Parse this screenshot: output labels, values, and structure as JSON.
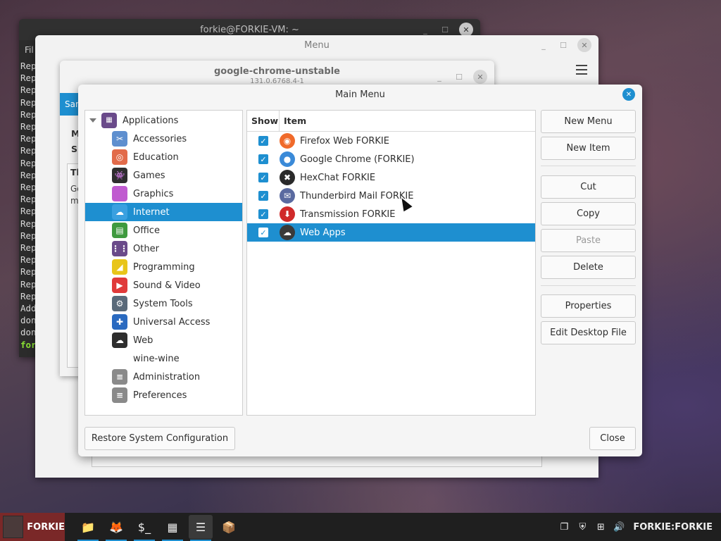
{
  "terminal": {
    "title": "forkie@FORKIE-VM: ~",
    "menu_stub": "Fil",
    "lines": [
      "Rep",
      "Rep",
      "Rep",
      "Rep",
      "Rep",
      "Rep",
      "Rep",
      "Rep",
      "Rep",
      "Rep",
      "Rep",
      "Rep",
      "Rep",
      "Rep",
      "Rep",
      "Rep",
      "Rep",
      "Rep",
      "Rep",
      "Rep",
      "Add",
      "don",
      "don"
    ],
    "prompt": "for"
  },
  "menu_window": {
    "title": "Menu"
  },
  "chrome_dialog": {
    "title": "google-chrome-unstable",
    "subtitle": "131.0.6768.4-1",
    "tab_stub": "Sam",
    "stub1": "M",
    "stub2": "Si",
    "frame_title": "Th",
    "frame_body1": "Go",
    "frame_body2": "m"
  },
  "main_dialog": {
    "title": "Main Menu",
    "tree_root": "Applications",
    "categories": [
      {
        "label": "Accessories",
        "icon": "accessories-icon",
        "color": "#5e8fcf",
        "glyph": "✂"
      },
      {
        "label": "Education",
        "icon": "education-icon",
        "color": "#e26b4a",
        "glyph": "◎"
      },
      {
        "label": "Games",
        "icon": "games-icon",
        "color": "#2e2e2e",
        "glyph": "👾"
      },
      {
        "label": "Graphics",
        "icon": "graphics-icon",
        "color": "#c05bd0",
        "glyph": ""
      },
      {
        "label": "Internet",
        "icon": "internet-icon",
        "color": "#3aa0e0",
        "glyph": "☁",
        "selected": true
      },
      {
        "label": "Office",
        "icon": "office-icon",
        "color": "#3f9a3f",
        "glyph": "▤"
      },
      {
        "label": "Other",
        "icon": "other-icon",
        "color": "#6a4a8a",
        "glyph": "⋮⋮"
      },
      {
        "label": "Programming",
        "icon": "programming-icon",
        "color": "#e8c51a",
        "glyph": "◢"
      },
      {
        "label": "Sound & Video",
        "icon": "sound-video-icon",
        "color": "#e03a3a",
        "glyph": "▶"
      },
      {
        "label": "System Tools",
        "icon": "system-tools-icon",
        "color": "#5a6a7a",
        "glyph": "⚙"
      },
      {
        "label": "Universal Access",
        "icon": "universal-access-icon",
        "color": "#2a6ac0",
        "glyph": "✚"
      },
      {
        "label": "Web",
        "icon": "web-icon",
        "color": "#2e2e2e",
        "glyph": "☁"
      },
      {
        "label": "wine-wine",
        "icon": "",
        "color": "",
        "glyph": "",
        "noicon": true
      },
      {
        "label": "Administration",
        "icon": "administration-icon",
        "color": "#8a8a8a",
        "glyph": "≡"
      },
      {
        "label": "Preferences",
        "icon": "preferences-icon",
        "color": "#8a8a8a",
        "glyph": "≡"
      }
    ],
    "table_headers": {
      "show": "Show",
      "item": "Item"
    },
    "items": [
      {
        "label": "Firefox Web FORKIE",
        "icon": "firefox-icon",
        "color": "#f06a2a",
        "glyph": "◉",
        "checked": true
      },
      {
        "label": "Google Chrome (FORKIE)",
        "icon": "chrome-icon",
        "color": "#3a8ad8",
        "glyph": "●",
        "checked": true
      },
      {
        "label": "HexChat FORKIE",
        "icon": "hexchat-icon",
        "color": "#2a2a2a",
        "glyph": "✖",
        "checked": true
      },
      {
        "label": "Thunderbird Mail FORKIE",
        "icon": "thunderbird-icon",
        "color": "#5a6aa0",
        "glyph": "✉",
        "checked": true
      },
      {
        "label": "Transmission FORKIE",
        "icon": "transmission-icon",
        "color": "#d02a2a",
        "glyph": "⬇",
        "checked": true
      },
      {
        "label": "Web Apps",
        "icon": "web-apps-icon",
        "color": "#3a3a3a",
        "glyph": "☁",
        "checked": true,
        "selected": true
      }
    ],
    "buttons": {
      "new_menu": "New Menu",
      "new_item": "New Item",
      "cut": "Cut",
      "copy": "Copy",
      "paste": "Paste",
      "delete": "Delete",
      "properties": "Properties",
      "edit_desktop_file": "Edit Desktop File",
      "restore": "Restore System Configuration",
      "close": "Close"
    }
  },
  "taskbar": {
    "start_label": "FORKIE",
    "apps": [
      {
        "name": "files-icon",
        "glyph": "📁"
      },
      {
        "name": "firefox-icon",
        "glyph": "🦊"
      },
      {
        "name": "terminal-icon",
        "glyph": "$_"
      },
      {
        "name": "apps-grid-icon",
        "glyph": "▦"
      },
      {
        "name": "menu-editor-icon",
        "glyph": "☰"
      },
      {
        "name": "archive-icon",
        "glyph": "📦"
      }
    ],
    "user_label": "FORKIE:FORKIE"
  }
}
